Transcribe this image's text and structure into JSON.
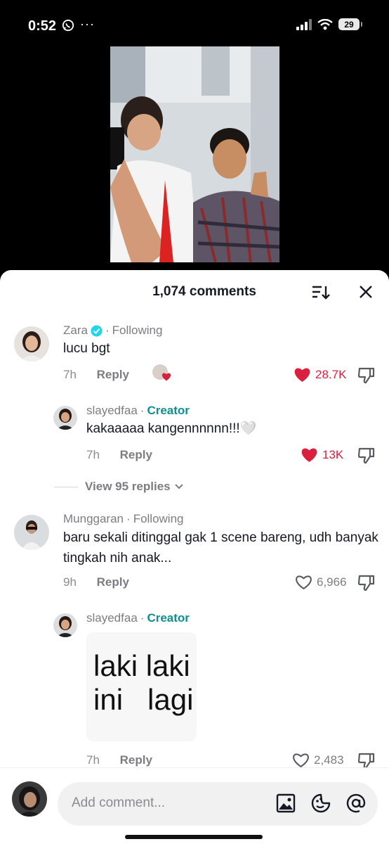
{
  "status": {
    "time": "0:52",
    "dots": "···",
    "battery": "29"
  },
  "header": {
    "title": "1,074 comments"
  },
  "comments": [
    {
      "name": "Zara",
      "follow": "Following",
      "text": "lucu bgt",
      "time": "7h",
      "reply": "Reply",
      "likes": "28.7K"
    },
    {
      "name": "slayedfaa",
      "role": "Creator",
      "text": "kakaaaaa kangennnnnn!!!🤍",
      "time": "7h",
      "reply": "Reply",
      "likes": "13K"
    },
    {
      "name": "Munggaran",
      "follow": "Following",
      "text": "baru sekali ditinggal gak 1 scene bareng, udh banyak tingkah nih anak...",
      "time": "9h",
      "reply": "Reply",
      "likes": "6,966"
    },
    {
      "name": "slayedfaa",
      "role": "Creator",
      "sticker_line1": "laki laki",
      "sticker_line2": "ini   lagi",
      "time": "7h",
      "reply": "Reply",
      "likes": "2,483"
    }
  ],
  "view_replies": "View 95 replies",
  "input": {
    "placeholder": "Add comment..."
  },
  "colors": {
    "like_red": "#d9203f",
    "creator_teal": "#0f8f91",
    "verified_blue": "#20d5ec"
  },
  "icons": [
    "whatsapp-icon",
    "signal-icon",
    "wifi-icon",
    "battery-icon",
    "sort-icon",
    "close-icon",
    "verified-icon",
    "heart-icon",
    "dislike-icon",
    "chevron-down-icon",
    "image-icon",
    "emoji-icon",
    "mention-icon"
  ]
}
